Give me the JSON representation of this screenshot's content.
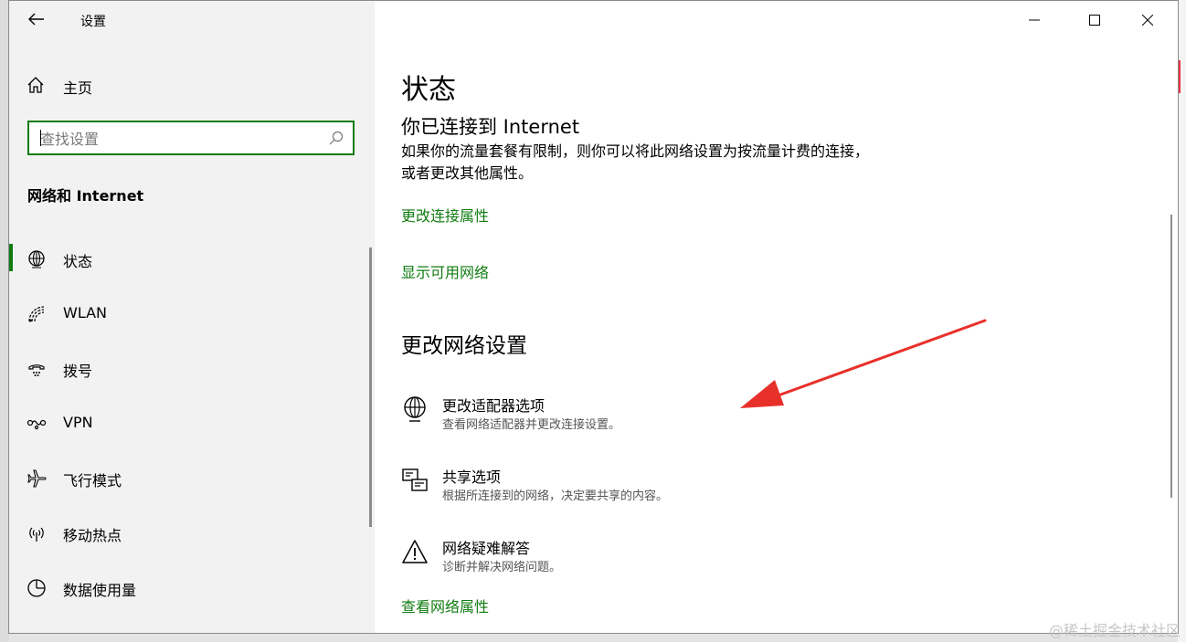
{
  "window": {
    "app_title": "设置",
    "home_label": "主页",
    "search_placeholder": "查找设置",
    "section_title": "网络和 Internet"
  },
  "sidebar": {
    "items": [
      {
        "label": "状态",
        "icon": "globe-icon",
        "active": true
      },
      {
        "label": "WLAN",
        "icon": "wifi-icon",
        "active": false
      },
      {
        "label": "拨号",
        "icon": "dialup-icon",
        "active": false
      },
      {
        "label": "VPN",
        "icon": "vpn-icon",
        "active": false
      },
      {
        "label": "飞行模式",
        "icon": "airplane-icon",
        "active": false
      },
      {
        "label": "移动热点",
        "icon": "hotspot-icon",
        "active": false
      },
      {
        "label": "数据使用量",
        "icon": "data-usage-icon",
        "active": false
      }
    ]
  },
  "main": {
    "page_title": "状态",
    "connection_title": "你已连接到 Internet",
    "connection_desc": "如果你的流量套餐有限制，则你可以将此网络设置为按流量计费的连接，或者更改其他属性。",
    "link_change_conn_props": "更改连接属性",
    "link_show_networks": "显示可用网络",
    "change_section_title": "更改网络设置",
    "options": [
      {
        "title": "更改适配器选项",
        "desc": "查看网络适配器并更改连接设置。",
        "icon": "adapter-icon"
      },
      {
        "title": "共享选项",
        "desc": "根据所连接到的网络，决定要共享的内容。",
        "icon": "sharing-icon"
      },
      {
        "title": "网络疑难解答",
        "desc": "诊断并解决网络问题。",
        "icon": "warning-icon"
      }
    ],
    "link_view_props": "查看网络属性"
  },
  "watermark": "@稀土掘金技术社区",
  "colors": {
    "accent": "#107c10",
    "arrow": "#e8302a"
  }
}
